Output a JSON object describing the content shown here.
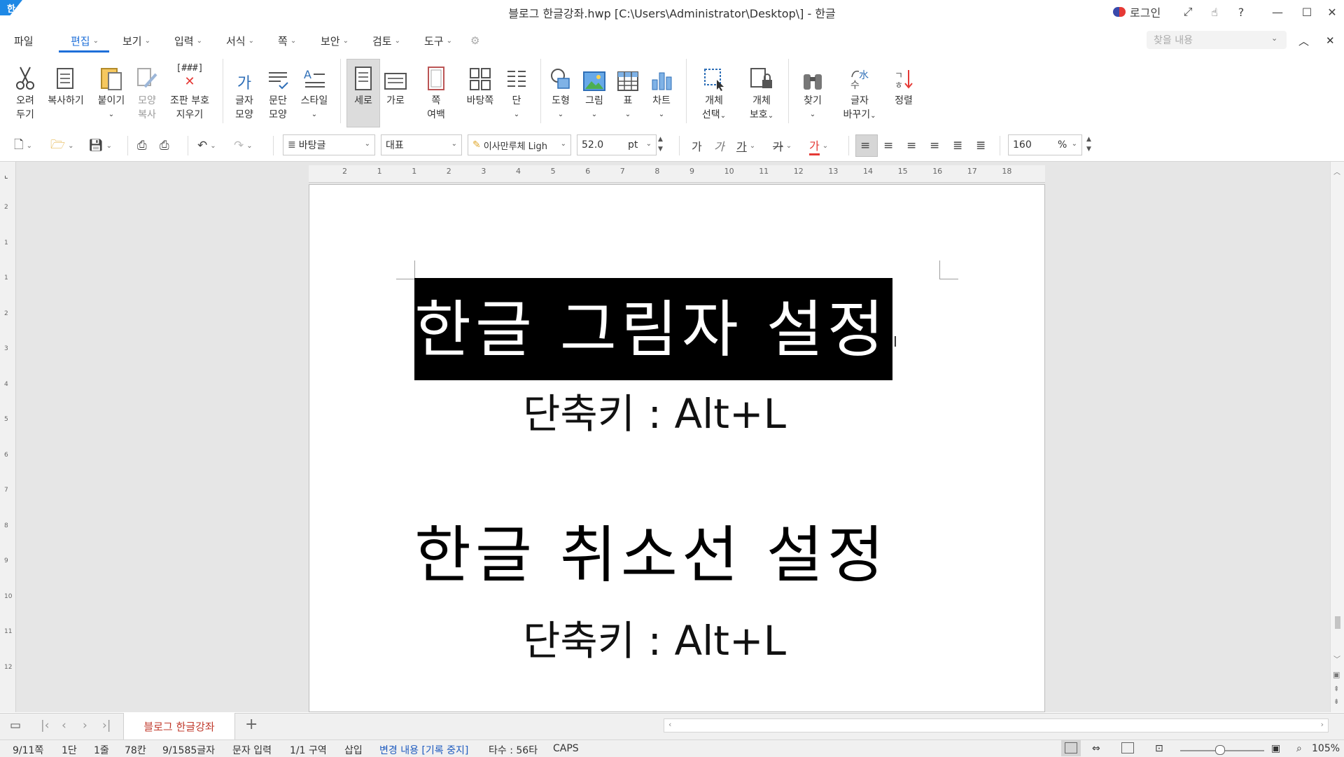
{
  "titlebar": {
    "logo": "한",
    "title": "블로그 한글강좌.hwp [C:\\Users\\Administrator\\Desktop\\] - 한글",
    "login_label": "로그인",
    "help": "?"
  },
  "menu": {
    "file": "파일",
    "items": [
      "편집",
      "보기",
      "입력",
      "서식",
      "쪽",
      "보안",
      "검토",
      "도구"
    ],
    "active": "편집"
  },
  "search": {
    "placeholder": "찾을 내용"
  },
  "ribbon": {
    "cut": [
      "오려",
      "두기"
    ],
    "copy": "복사하기",
    "paste": "붙이기",
    "format_copy": [
      "모양",
      "복사"
    ],
    "clear_codes": [
      "조판 부호",
      "지우기"
    ],
    "clear_codes_icon_text": "[###]",
    "char_shape": [
      "글자",
      "모양"
    ],
    "para_shape": [
      "문단",
      "모양"
    ],
    "style": "스타일",
    "vertical": "세로",
    "horizontal": "가로",
    "page_margin": [
      "쪽",
      "여백"
    ],
    "master_page": "바탕쪽",
    "column": "단",
    "shape": "도형",
    "picture": "그림",
    "table": "표",
    "chart": "차트",
    "select_object": [
      "개체",
      "선택"
    ],
    "protect_object": [
      "개체",
      "보호"
    ],
    "find": "찾기",
    "replace_char": [
      "글자",
      "바꾸기"
    ],
    "sort": "정렬"
  },
  "toolbar": {
    "style_value": "바탕글",
    "lang_value": "대표",
    "font_value": "이사만루체 Ligh",
    "size_value": "52.0",
    "size_unit": "pt",
    "bold": "가",
    "italic": "가",
    "underline": "가",
    "strike": "가",
    "color": "가",
    "zoom_value": "160",
    "zoom_unit": "%"
  },
  "ruler": {
    "h_ticks": [
      "2",
      "1",
      "1",
      "2",
      "3",
      "4",
      "5",
      "6",
      "7",
      "8",
      "9",
      "10",
      "11",
      "12",
      "13",
      "14",
      "15",
      "16",
      "17",
      "18"
    ],
    "v_ticks": [
      "2",
      "1",
      "1",
      "2",
      "3",
      "4",
      "5",
      "6",
      "7",
      "8",
      "9",
      "10",
      "11",
      "12"
    ]
  },
  "document": {
    "heading1": "한글 그림자 설정",
    "shortcut1": "단축키 : Alt+L",
    "heading2": "한글 취소선 설정",
    "shortcut2": "단축키 : Alt+L"
  },
  "tabs": {
    "active_tab": "블로그 한글강좌",
    "add": "+"
  },
  "status": {
    "page": "9/11쪽",
    "column": "1단",
    "line": "1줄",
    "col": "78칸",
    "chars": "9/1585글자",
    "input_mode": "문자 입력",
    "section": "1/1 구역",
    "insert": "삽입",
    "track_changes": "변경 내용 [기록 중지]",
    "typing_speed": "타수 : 56타",
    "caps": "CAPS",
    "zoom": "105%"
  }
}
